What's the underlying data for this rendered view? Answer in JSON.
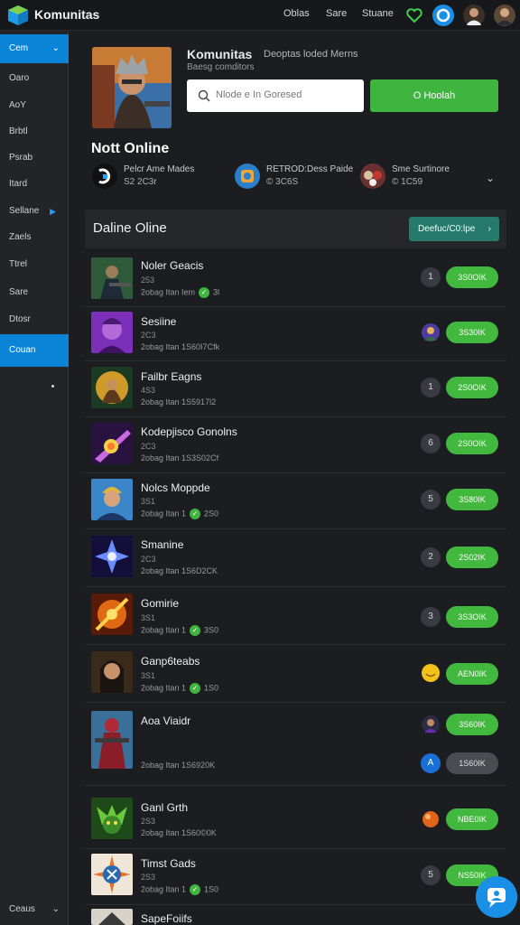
{
  "header": {
    "app_title": "Komunitas",
    "links": [
      "Oblas",
      "Sare",
      "Stuane"
    ]
  },
  "sidebar": {
    "items": [
      {
        "label": "Cem",
        "active": true
      },
      {
        "label": "Oaro"
      },
      {
        "label": "AoY"
      },
      {
        "label": "Brbtl"
      },
      {
        "label": "Psrab"
      },
      {
        "label": "Itard"
      },
      {
        "label": "Sellane"
      },
      {
        "label": "Zaels"
      },
      {
        "label": "Ttrel"
      },
      {
        "label": "Sare"
      },
      {
        "label": "Dtosr"
      },
      {
        "label": "Couan",
        "active": true
      }
    ],
    "footer_label": "Ceaus"
  },
  "hero": {
    "title": "Komunitas",
    "description": "Deoptas loded Merns",
    "subtitle": "Baesg comditors",
    "search_placeholder": "Nlode e In Goresed",
    "action_label": "O Hoolah"
  },
  "online": {
    "title": "Nott Online",
    "users": [
      {
        "name": "Pelcr Ame Mades",
        "meta": "S2 2C3r"
      },
      {
        "name": "RETROD:Dess Paide",
        "meta": "© 3C6S"
      },
      {
        "name": "Sme Surtinore",
        "meta": "© 1C59"
      }
    ]
  },
  "list": {
    "title": "Daline Oline",
    "button_label": "Deefuc/C0:lpe",
    "rows": [
      {
        "title": "Noler Geacis",
        "sub": "253",
        "meta": "2obag Itan Iem",
        "count": "3l",
        "badge": "1",
        "pill": "3S0OIK",
        "verified": true
      },
      {
        "title": "Sesiine",
        "sub": "2C3",
        "meta": "2obag Itan 1S60I7Cfk",
        "count": "",
        "badge": "avatar",
        "pill": "3S30IK",
        "verified": false
      },
      {
        "title": "Failbr Eagns",
        "sub": "4S3",
        "meta": "2obag Itan 1S5917l2",
        "count": "",
        "badge": "1",
        "pill": "2S0OIK",
        "verified": false
      },
      {
        "title": "Kodepjisco Gonolns",
        "sub": "2C3",
        "meta": "2obag Itan 1S3S02Cf",
        "count": "",
        "badge": "6",
        "pill": "2S0OIK",
        "verified": false
      },
      {
        "title": "Nolcs Moppde",
        "sub": "3S1",
        "meta": "2obag Itan 1",
        "count": "2S0",
        "badge": "5",
        "pill": "3S80IK",
        "verified": true
      },
      {
        "title": "Smanine",
        "sub": "2C3",
        "meta": "2obag Itan 1S6D2CK",
        "count": "",
        "badge": "2",
        "pill": "2S02IK",
        "verified": false
      },
      {
        "title": "Gomirie",
        "sub": "3S1",
        "meta": "2obag Itan 1",
        "count": "3S0",
        "badge": "3",
        "pill": "3S3OIK",
        "verified": true
      },
      {
        "title": "Ganp6teabs",
        "sub": "3S1",
        "meta": "2obag Itan 1",
        "count": "1S0",
        "badge": "smile",
        "pill": "AEN0IK",
        "verified": true
      },
      {
        "title": "Aoa Viaidr",
        "sub": "",
        "meta": "2obag Itan 1S6920K",
        "count": "",
        "badge": "avatar2",
        "pill": "3S60IK",
        "verified": false,
        "extra_badge": "A",
        "extra_pill": "1S60IK"
      },
      {
        "title": "Ganl Grth",
        "sub": "2S3",
        "meta": "2obag Itan 1S60©0K",
        "count": "",
        "badge": "orb",
        "pill": "NBE0IK",
        "verified": false
      },
      {
        "title": "Timst Gads",
        "sub": "2S3",
        "meta": "2obag Itan 1",
        "count": "1S0",
        "badge": "5",
        "pill": "NS50IK",
        "verified": true
      },
      {
        "title": "SapeFoiifs",
        "sub": "",
        "meta": "",
        "count": "",
        "badge": "",
        "pill": "",
        "verified": false
      }
    ]
  },
  "colors": {
    "accent_blue": "#0a84d6",
    "green": "#43b83f",
    "teal": "#257a6b",
    "background": "#1c1d20"
  }
}
